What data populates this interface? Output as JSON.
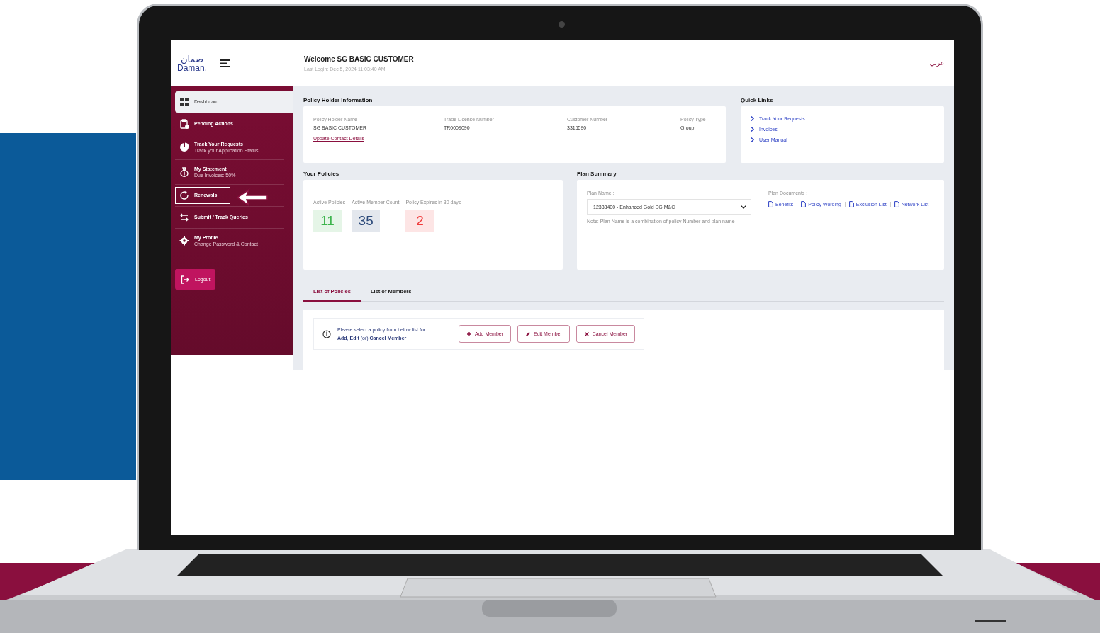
{
  "header": {
    "logo_arabic": "ضمان",
    "logo_latin": "Daman.",
    "welcome": "Welcome SG BASIC CUSTOMER",
    "last_login": "Last Login: Dec 5, 2024 11:03:40 AM",
    "language": "عربي"
  },
  "sidebar": {
    "items": [
      {
        "label": "Dashboard",
        "selected": true,
        "highlighted": false
      },
      {
        "label": "Pending Actions",
        "selected": false,
        "highlighted": false
      },
      {
        "label": "Track Your Requests",
        "subtitle": "Track your Application Status",
        "selected": false,
        "highlighted": false
      },
      {
        "label": "My Statement",
        "subtitle": "Due Invoices: 50%",
        "selected": false,
        "highlighted": false
      },
      {
        "label": "Renewals",
        "selected": false,
        "highlighted": true
      },
      {
        "label": "Submit / Track Queries",
        "selected": false,
        "highlighted": false
      },
      {
        "label": "My Profile",
        "subtitle": "Change Password & Contact",
        "selected": false,
        "highlighted": false
      }
    ],
    "logout": "Logout"
  },
  "policy_holder": {
    "title": "Policy Holder Information",
    "fields": [
      {
        "label": "Policy Holder Name",
        "value": "SG BASIC CUSTOMER"
      },
      {
        "label": "Trade License Number",
        "value": "TR0009090"
      },
      {
        "label": "Customer Number",
        "value": "3315590"
      },
      {
        "label": "Policy Type",
        "value": "Group"
      }
    ],
    "link": "Update Contact Details"
  },
  "quick_links": {
    "title": "Quick Links",
    "items": [
      "Track Your Requests",
      "Invoices",
      "User Manual"
    ]
  },
  "policies": {
    "title": "Your Policies",
    "stats": [
      {
        "label": "Active Policies",
        "value": "11",
        "color": "#3cb44b"
      },
      {
        "label": "Active Member Count",
        "value": "35",
        "color": "#2c4a7a"
      },
      {
        "label": "Policy Expires in 30 days",
        "value": "2",
        "color": "#f03a3a"
      }
    ]
  },
  "plan_summary": {
    "title": "Plan Summary",
    "plan_label": "Plan Name :",
    "plan_value": "12338400 - Enhanced Gold SG M&C",
    "note": "Note: Plan Name is a combination of policy Number and plan name",
    "documents_label": "Plan Documents :",
    "documents": [
      "Benefits",
      "Policy Wording",
      "Exclusion List",
      "Network List"
    ]
  },
  "tabs": [
    {
      "label": "List of Policies",
      "selected": true
    },
    {
      "label": "List of Members",
      "selected": false
    }
  ],
  "member_actions": {
    "message": "Please select a policy from below list for",
    "message_line2": "**Add**, **Edit** (or) **Cancel Member**",
    "buttons": [
      {
        "label": "Add Member"
      },
      {
        "label": "Edit Member"
      },
      {
        "label": "Cancel Member"
      }
    ]
  }
}
